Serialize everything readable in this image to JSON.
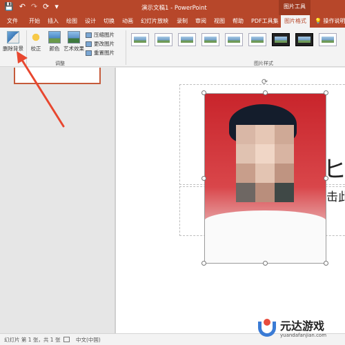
{
  "titlebar": {
    "save_glyph": "💾",
    "undo_glyph": "↶",
    "redo_glyph": "↷",
    "repeat_glyph": "⟳",
    "more_glyph": "▾",
    "title": "演示文稿1  -  PowerPoint",
    "context_group": "图片工具"
  },
  "tabs": [
    "文件",
    "开始",
    "插入",
    "绘图",
    "设计",
    "切换",
    "动画",
    "幻灯片放映",
    "录制",
    "审阅",
    "视图",
    "帮助",
    "PDF工具集",
    "图片格式"
  ],
  "tell_me": "操作说明",
  "ribbon": {
    "remove_background": "删除背景",
    "corrections": "校正",
    "color": "颜色",
    "artistic_effects": "艺术效果",
    "compress": "压缩图片",
    "change": "更改图片",
    "reset": "重置图片",
    "adjust_group": "调整",
    "styles_group": "图片样式"
  },
  "slide": {
    "title_partial": "ヒ娃",
    "subtitle_partial": "击此"
  },
  "status": {
    "slide_info": "幻灯片 第 1 张，共 1 张",
    "language": "中文(中国)"
  },
  "watermark": {
    "name": "元达游戏",
    "url": "yuandafanjian.com"
  },
  "colors": {
    "accent": "#b7472a",
    "arrow": "#e8472f"
  }
}
